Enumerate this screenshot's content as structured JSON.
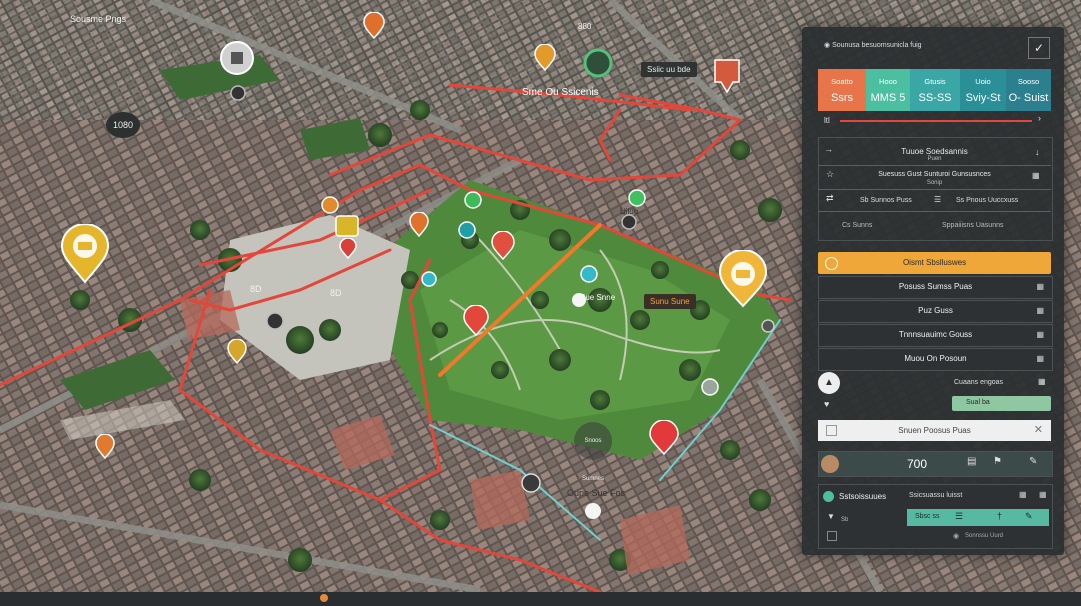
{
  "map": {
    "title": "Sousme Pngs",
    "labels": {
      "center_title": "Sme Ou Ssicenis",
      "top_tag": "Ssiic uu bde",
      "near_count": "1080",
      "left_value": "8D",
      "mid_value": "8D",
      "park_title": "Uiido",
      "park_sub": "Sue Snne",
      "south_label": "Oupe Sue Fos",
      "east_tag": "Sunu Sune",
      "top_small": "880",
      "center_grey": "Snoos Sumnes"
    },
    "route_colors": {
      "main": "#e2473a",
      "accent": "#f07a2a",
      "water": "#6fd0d0"
    }
  },
  "panel": {
    "header": "Sounusa besuomsunicla fuig",
    "check_icon": "check-icon",
    "stats": [
      {
        "title": "Soatto",
        "value": "Ssrs",
        "color": "#e8744a"
      },
      {
        "title": "Hooo",
        "value": "MMS 5",
        "color": "#4bbfa0"
      },
      {
        "title": "Gtusis",
        "value": "SS-SS",
        "color": "#3aa7a6"
      },
      {
        "title": "Uoio",
        "value": "Sviy-St",
        "color": "#2b8f97"
      },
      {
        "title": "Sooso",
        "value": "O- Suist",
        "color": "#2c7f8e"
      }
    ],
    "progress_label": "ltl",
    "section1": {
      "title": "Tuuoe Soedsannis",
      "sub": "Puen",
      "row1_main": "Suesuss Gust Sunturoi Gunsusnces",
      "row1_sub": "Sonip",
      "row2_left": "Sb Sunnos Puss",
      "row2_right": "Ss Pnous Uuccxuss",
      "row3_left": "Cs Sunns",
      "row3_right": "Sppaiiisns Uasunns"
    },
    "active_bar": "Oismt Sbslluswes",
    "list": [
      "Posuss Sumss Puas",
      "Puz Guss",
      "Tnnnsuauimc Gouss",
      "Muou On Posoun"
    ],
    "filter_label": "Cuaans engoas",
    "filter_button": "Sual  ba",
    "search_row": "Snuen Poosus Puas",
    "value_row": "700",
    "section2": {
      "title": "Sstsoissuues",
      "sub": "Ssicsuassu luisst",
      "tag": "Sb",
      "val": "Sbsc ss",
      "footer": "Sonnssu Uurd"
    }
  }
}
